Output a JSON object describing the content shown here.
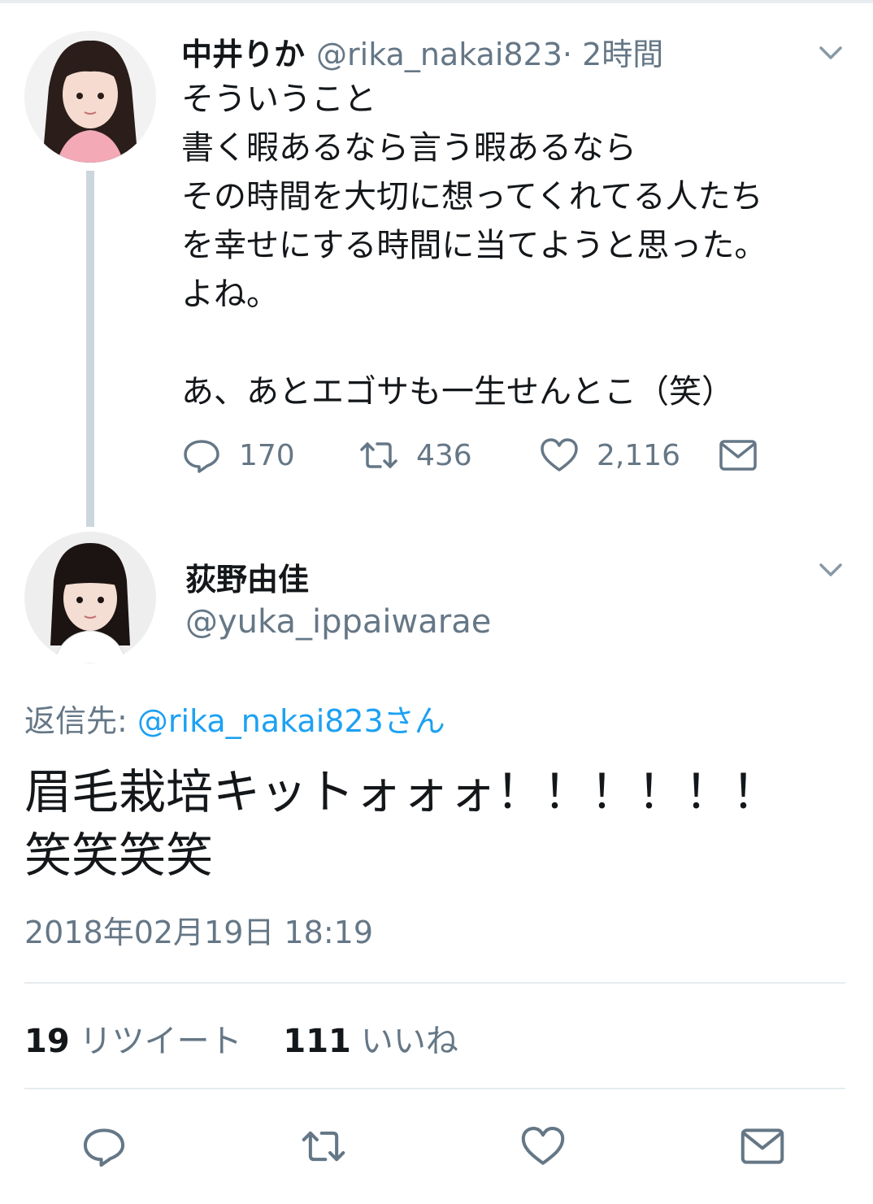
{
  "parent_tweet": {
    "author_name": "中井りか",
    "author_handle": "@rika_nakai823",
    "time": " · 2時間",
    "text_lines": [
      "そういうこと",
      "書く暇あるなら言う暇あるなら",
      "その時間を大切に想ってくれてる人たち",
      "を幸せにする時間に当てようと思った。",
      "よね。",
      "",
      "あ、あとエゴサも一生せんとこ（笑）"
    ],
    "replies": "170",
    "retweets": "436",
    "likes": "2,116",
    "icons": [
      "reply-icon",
      "retweet-icon",
      "like-icon",
      "dm-icon",
      "chevron-down-icon"
    ]
  },
  "reply_tweet": {
    "author_name": "荻野由佳",
    "author_handle": "@yuka_ippaiwarae",
    "reply_to_prefix": "返信先: ",
    "reply_to_link": "@rika_nakai823さん",
    "text_lines": [
      "眉毛栽培キットォォォ！！！！！！",
      "笑笑笑笑"
    ],
    "timestamp": "2018年02月19日 18:19",
    "retweet_count": "19",
    "retweet_label": "リツイート",
    "like_count": "111",
    "like_label": "いいね"
  },
  "colors": {
    "text": "#14171a",
    "secondary": "#657786",
    "link": "#1da1f2",
    "thread_line": "#ccd6dd",
    "divider": "#e6ecf0"
  }
}
